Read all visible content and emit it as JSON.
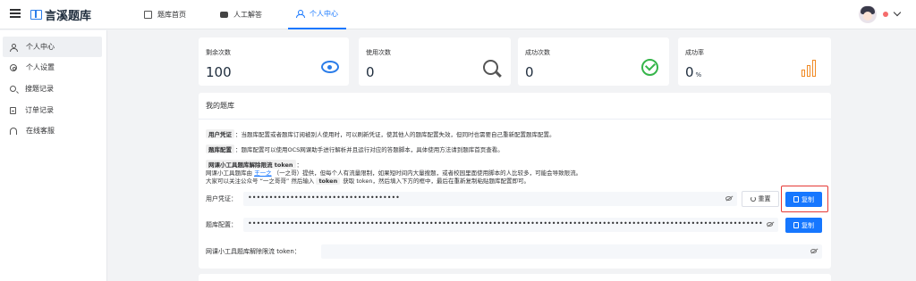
{
  "header": {
    "brand": "言溪题库",
    "tabs": [
      {
        "label": "题库首页",
        "icon": "book-icon"
      },
      {
        "label": "人工解答",
        "icon": "robot-icon"
      },
      {
        "label": "个人中心",
        "icon": "user-icon",
        "active": true
      }
    ]
  },
  "sidebar": {
    "items": [
      {
        "label": "个人中心",
        "icon": "user-icon",
        "active": true
      },
      {
        "label": "个人设置",
        "icon": "gear-icon"
      },
      {
        "label": "搜题记录",
        "icon": "search-icon"
      },
      {
        "label": "订单记录",
        "icon": "document-icon"
      },
      {
        "label": "在线客服",
        "icon": "headset-icon"
      }
    ]
  },
  "stats": [
    {
      "label": "剩余次数",
      "value": "100",
      "unit": "",
      "icon": "eye-icon",
      "color": "#2b7de9"
    },
    {
      "label": "使用次数",
      "value": "0",
      "unit": "",
      "icon": "magnifier-icon",
      "color": "#555555"
    },
    {
      "label": "成功次数",
      "value": "0",
      "unit": "",
      "icon": "check-circle-icon",
      "color": "#36b54a"
    },
    {
      "label": "成功率",
      "value": "0",
      "unit": "%",
      "icon": "bar-chart-icon",
      "color": "#f08a24"
    }
  ],
  "panel": {
    "title": "我的题库",
    "notes": {
      "credential_tag": "用户凭证",
      "credential_text": "：当题库配置或者题库订阅被别人使用时，可以刷新凭证，使其他人的题库配置失效，但同时也需要自己重新配置题库配置。",
      "config_tag": "题库配置",
      "config_text": "：题库配置可以使用OCS网课助手进行解析并且运行对应的答题脚本，具体使用方法请到题库首页查看。",
      "token_tag_prefix": "网课小工具题库解除限流",
      "token_tag": "token",
      "token_tag_suffix": "：",
      "token_line1_a": "网课小工具题库由",
      "token_line1_link": "王一之",
      "token_line1_b": "（一之哥）提供，但每个人有流量限制，如果短时间内大量搜题，或者校园里面使用脚本的人比较多，可能会导致限流。",
      "token_line2_a": "大家可以关注公众号 “一之哥哥” 然后输入",
      "token_line2_tag": "token",
      "token_line2_b": "获取 token，然后填入下方的框中，最后在重新复制粘贴题库配置即可。"
    },
    "form": {
      "credential_label": "用户凭证：",
      "credential_value": "••••••••••••••••••••••••••••••••••••",
      "reset_label": "重置",
      "copy_label": "复制",
      "config_label": "题库配置：",
      "config_value": "•••••••••••••••••••••••••••••••••••••••••••••••••••••••••••••••••••••••••••••••••••••••••••••••••••••••••••••••••••••••••••••••••••••••••",
      "config_copy_label": "复制",
      "token_label": "网课小工具题库解除限流 token：",
      "token_value": ""
    }
  },
  "colors": {
    "accent": "#1677ff",
    "highlight": "#e53935"
  }
}
